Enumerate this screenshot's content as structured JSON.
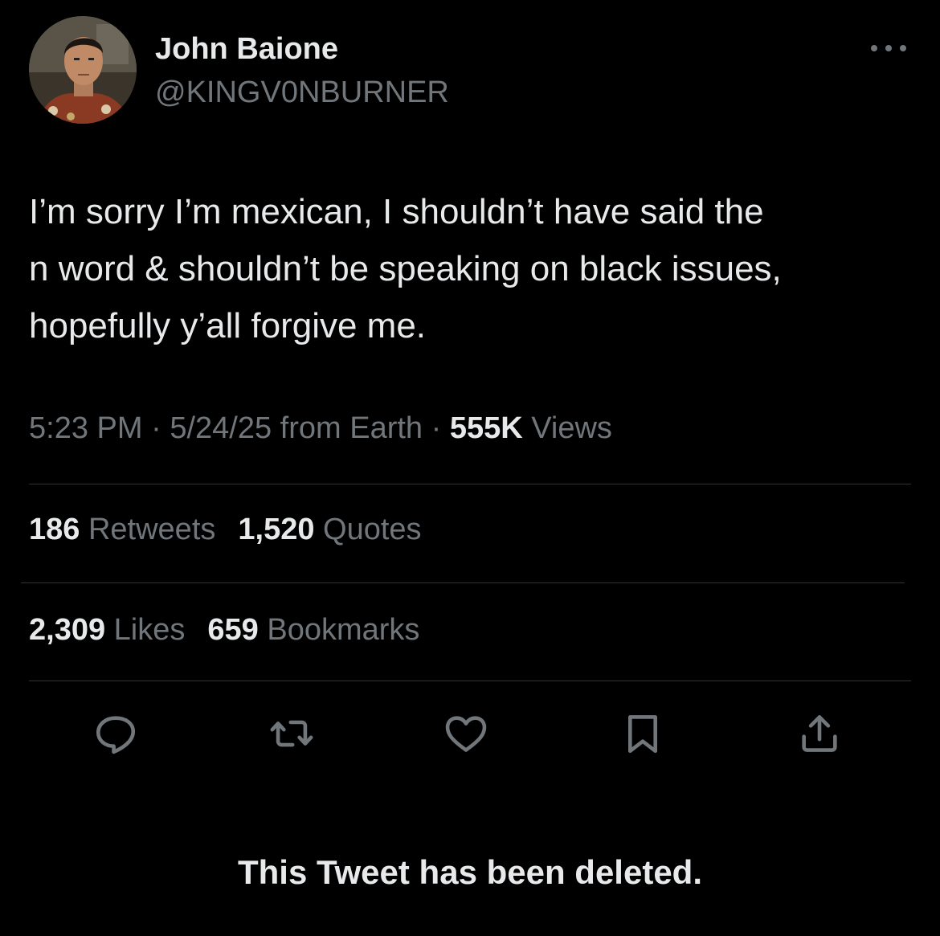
{
  "author": {
    "display_name": "John Baione",
    "handle": "@KINGV0NBURNER",
    "avatar_icon": "profile-avatar"
  },
  "tweet": {
    "text_lines": [
      "I’m sorry I’m mexican, I shouldn’t have said the",
      "n word & shouldn’t be speaking on black issues,",
      "hopefully y’all forgive me."
    ]
  },
  "meta": {
    "time": "5:23 PM",
    "date": "5/24/25",
    "source": "from Earth",
    "separator": "·",
    "views_count": "555K",
    "views_label": "Views"
  },
  "stats": {
    "retweets_count": "186",
    "retweets_label": "Retweets",
    "quotes_count": "1,520",
    "quotes_label": "Quotes",
    "likes_count": "2,309",
    "likes_label": "Likes",
    "bookmarks_count": "659",
    "bookmarks_label": "Bookmarks"
  },
  "actions": {
    "icons": [
      "reply-icon",
      "retweet-icon",
      "like-icon",
      "bookmark-icon",
      "share-icon"
    ],
    "icon_color": "#71767b"
  },
  "notice": {
    "deleted_text": "This Tweet has been deleted."
  },
  "colors": {
    "background": "#000000",
    "primary_text": "#e7e9ea",
    "secondary_text": "#71767b",
    "divider": "#2f3336"
  }
}
